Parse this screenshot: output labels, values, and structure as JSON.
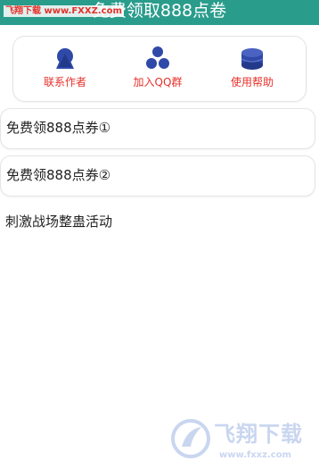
{
  "header": {
    "title": "免费领取888点卷",
    "watermark": "飞翔下载 www.FXXZ.com"
  },
  "quick_actions": [
    {
      "label": "联系作者",
      "icon": "person-icon"
    },
    {
      "label": "加入QQ群",
      "icon": "group-icon"
    },
    {
      "label": "使用帮助",
      "icon": "database-icon"
    }
  ],
  "cards": [
    {
      "label": "免费领888点券①"
    },
    {
      "label": "免费领888点券②"
    }
  ],
  "activity": {
    "label": "刺激战场整蛊活动"
  },
  "footer_watermark": {
    "text": "飞翔下载",
    "url": "www.fxxz.com"
  },
  "colors": {
    "header_bg": "#2a9c8c",
    "accent": "#e8302a",
    "icon": "#2f49a8"
  }
}
